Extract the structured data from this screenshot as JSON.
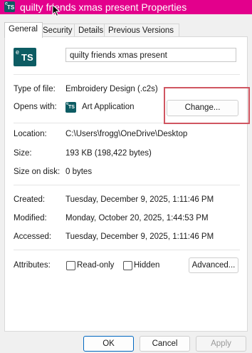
{
  "window": {
    "title": "quilty friends xmas present Properties",
    "icon": "ts-app-icon",
    "accent": "#e3008c"
  },
  "tabs": [
    {
      "label": "General",
      "active": true
    },
    {
      "label": "Security",
      "active": false
    },
    {
      "label": "Details",
      "active": false
    },
    {
      "label": "Previous Versions",
      "active": false
    }
  ],
  "file": {
    "name": "quilty friends xmas present",
    "icon_label": "TS",
    "icon_small_label": "e"
  },
  "properties": {
    "type_label": "Type of file:",
    "type_value": "Embroidery Design (.c2s)",
    "opens_label": "Opens with:",
    "opens_value": "Art Application",
    "change_button": "Change...",
    "location_label": "Location:",
    "location_value": "C:\\Users\\frogg\\OneDrive\\Desktop",
    "size_label": "Size:",
    "size_value": "193 KB (198,422 bytes)",
    "size_disk_label": "Size on disk:",
    "size_disk_value": "0 bytes",
    "created_label": "Created:",
    "created_value": "Tuesday, December 9, 2025, 1:11:46 PM",
    "modified_label": "Modified:",
    "modified_value": "Monday, October 20, 2025, 1:44:53 PM",
    "accessed_label": "Accessed:",
    "accessed_value": "Tuesday, December 9, 2025, 1:11:46 PM",
    "attributes_label": "Attributes:",
    "readonly_label": "Read-only",
    "readonly_checked": false,
    "hidden_label": "Hidden",
    "hidden_checked": false,
    "advanced_button": "Advanced..."
  },
  "footer": {
    "ok": "OK",
    "cancel": "Cancel",
    "apply": "Apply"
  },
  "annotation": {
    "highlight_color": "#d05661"
  }
}
